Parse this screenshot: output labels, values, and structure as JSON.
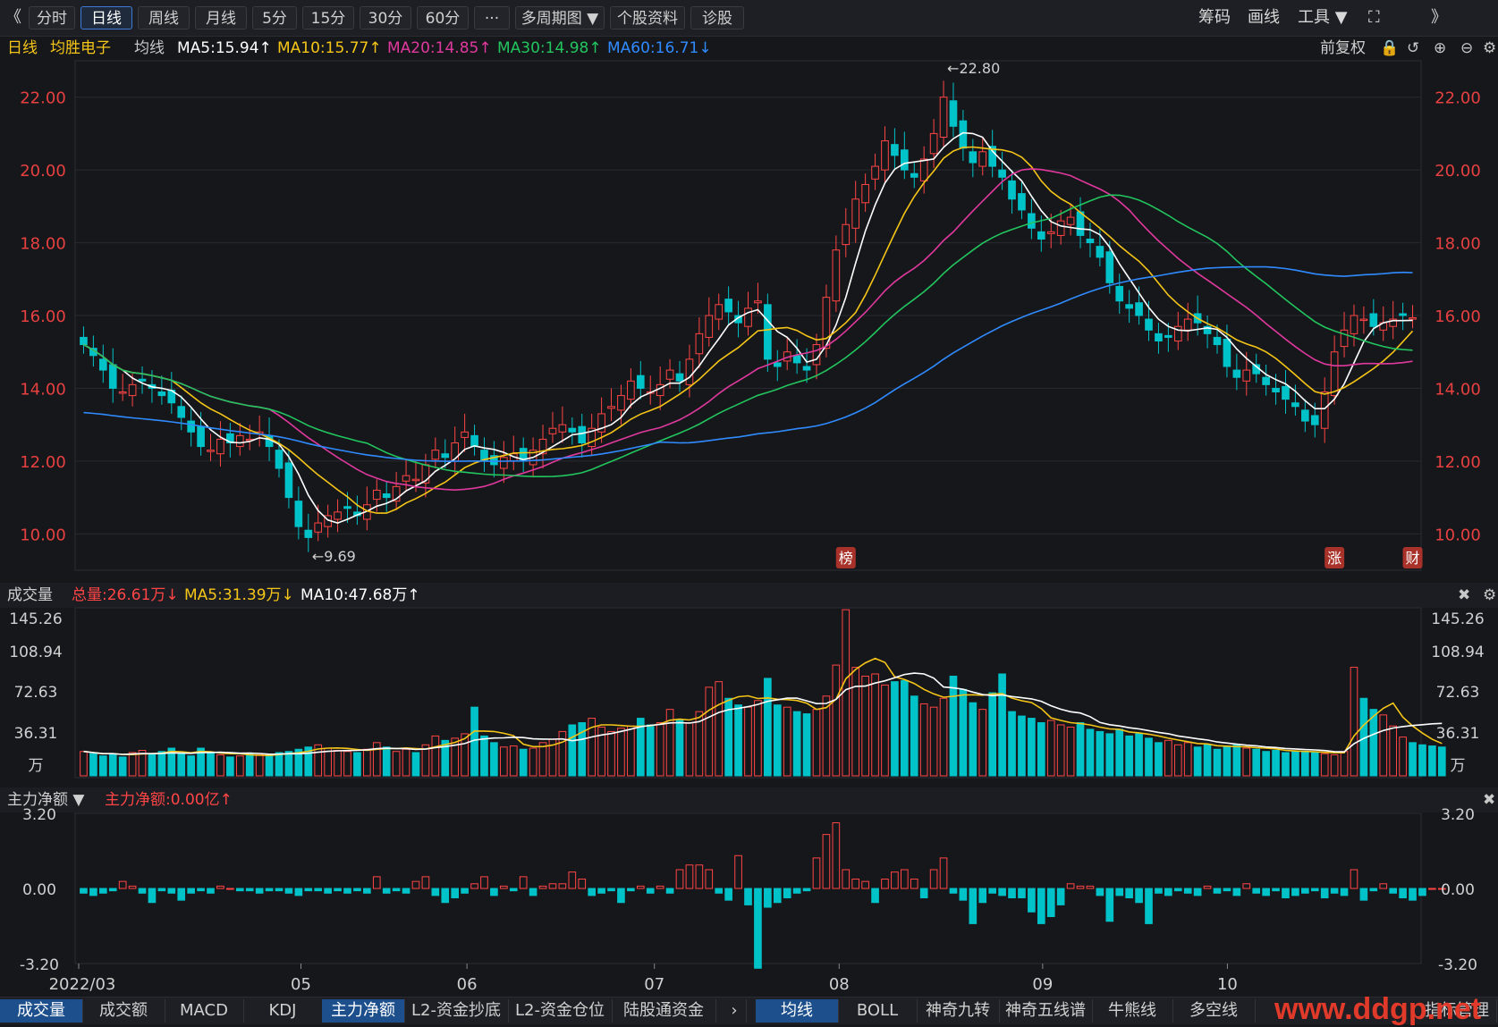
{
  "toolbar": {
    "back": "《",
    "tabs": [
      "分时",
      "日线",
      "周线",
      "月线",
      "5分",
      "15分",
      "30分",
      "60分",
      "···",
      "多周期图 ▼",
      "个股资料",
      "诊股"
    ],
    "active_tab": 1,
    "right": [
      "筹码",
      "画线",
      "工具 ▼",
      "⛶",
      "》"
    ]
  },
  "main_header": {
    "period": "日线",
    "stock_name": "均胜电子",
    "ma_label": "均线",
    "ma5": "MA5:15.94↑",
    "ma10": "MA10:15.77↑",
    "ma20": "MA20:14.85↑",
    "ma30": "MA30:14.98↑",
    "ma60": "MA60:16.71↓",
    "adjust": "前复权"
  },
  "price_axis": [
    "22.00",
    "20.00",
    "18.00",
    "16.00",
    "14.00",
    "12.00",
    "10.00"
  ],
  "annotations": {
    "high": "←22.80",
    "low": "←9.69",
    "tag1": "榜",
    "tag2": "涨",
    "tag3": "财"
  },
  "volume_header": {
    "label": "成交量",
    "total": "总量:26.61万↓",
    "ma5": "MA5:31.39万↓",
    "ma10": "MA10:47.68万↑"
  },
  "volume_axis": [
    "145.26",
    "108.94",
    "72.63",
    "36.31",
    "万"
  ],
  "flow_header": {
    "label": "主力净额 ▼",
    "value": "主力净额:0.00亿↑"
  },
  "flow_axis": [
    "3.20",
    "0.00",
    "-3.20"
  ],
  "x_axis": [
    "2022/03",
    "05",
    "06",
    "07",
    "08",
    "09",
    "10"
  ],
  "bottom_tabs_left": [
    "成交量",
    "成交额",
    "MACD",
    "KDJ",
    "主力净额",
    "L2-资金抄底",
    "L2-资金仓位",
    "陆股通资金"
  ],
  "bottom_tabs_right": [
    "均线",
    "BOLL",
    "神奇九转",
    "神奇五线谱",
    "牛熊线",
    "多空线"
  ],
  "bottom_right": "指标管理",
  "watermark": "www.ddgp.net",
  "colors": {
    "up": "#ff4545",
    "down": "#00c3c9",
    "ma5": "#ffffff",
    "ma10": "#f5c518",
    "ma20": "#e0399e",
    "ma30": "#22c55e",
    "ma60": "#2f8bff"
  },
  "chart_data": [
    {
      "type": "candlestick",
      "title": "均胜电子 日线",
      "x_ticks": [
        "2022/03",
        "05",
        "06",
        "07",
        "08",
        "09",
        "10"
      ],
      "ylim": [
        9.0,
        23.0
      ],
      "ohlc_close": [
        15.2,
        14.9,
        14.5,
        14.0,
        13.9,
        14.1,
        14.2,
        14.0,
        13.8,
        13.6,
        13.2,
        12.8,
        12.4,
        12.3,
        12.6,
        12.5,
        12.7,
        12.6,
        12.8,
        12.4,
        11.8,
        11.0,
        10.2,
        9.9,
        10.3,
        10.5,
        10.6,
        10.7,
        10.5,
        10.8,
        11.2,
        11.0,
        11.3,
        11.6,
        11.5,
        11.9,
        12.3,
        12.1,
        12.5,
        12.8,
        12.4,
        12.0,
        11.9,
        12.1,
        12.2,
        12.0,
        12.3,
        12.6,
        12.9,
        13.0,
        12.8,
        12.5,
        12.9,
        13.3,
        13.5,
        13.8,
        14.2,
        14.0,
        13.9,
        14.1,
        14.5,
        14.2,
        14.8,
        15.5,
        16.0,
        16.3,
        16.1,
        15.8,
        16.2,
        16.4,
        14.8,
        14.6,
        15.0,
        14.7,
        14.5,
        15.2,
        16.5,
        17.8,
        18.5,
        19.2,
        19.6,
        20.1,
        20.8,
        20.4,
        20.0,
        19.8,
        20.3,
        21.0,
        22.0,
        21.2,
        20.6,
        20.2,
        20.5,
        20.1,
        19.8,
        19.2,
        18.9,
        18.4,
        18.1,
        18.3,
        18.6,
        18.7,
        18.2,
        18.0,
        17.6,
        16.9,
        16.4,
        16.2,
        16.0,
        15.6,
        15.3,
        15.4,
        15.7,
        15.9,
        15.8,
        15.5,
        15.2,
        14.6,
        14.3,
        14.5,
        14.4,
        14.1,
        13.9,
        13.7,
        13.5,
        13.1,
        13.0,
        13.9,
        15.0,
        15.6,
        16.0,
        15.9,
        15.7,
        15.8,
        15.9,
        16.0,
        15.94
      ],
      "ma_last": {
        "MA5": 15.94,
        "MA10": 15.77,
        "MA20": 14.85,
        "MA30": 14.98,
        "MA60": 16.71
      },
      "high_label": 22.8,
      "low_label": 9.69
    },
    {
      "type": "bar",
      "title": "成交量",
      "unit": "万",
      "ylim": [
        0,
        145.26
      ],
      "values": [
        22,
        20,
        18,
        20,
        17,
        21,
        23,
        19,
        22,
        25,
        20,
        18,
        25,
        21,
        19,
        17,
        18,
        20,
        19,
        18,
        21,
        22,
        24,
        26,
        28,
        25,
        23,
        22,
        21,
        24,
        30,
        26,
        22,
        24,
        21,
        28,
        36,
        32,
        34,
        38,
        62,
        36,
        30,
        26,
        27,
        24,
        25,
        30,
        33,
        40,
        46,
        48,
        52,
        44,
        40,
        43,
        45,
        52,
        46,
        48,
        60,
        50,
        48,
        58,
        80,
        85,
        70,
        64,
        62,
        68,
        88,
        64,
        62,
        58,
        56,
        60,
        72,
        100,
        150,
        98,
        90,
        92,
        82,
        85,
        86,
        72,
        65,
        62,
        70,
        90,
        78,
        66,
        60,
        75,
        92,
        58,
        54,
        52,
        48,
        50,
        46,
        44,
        48,
        42,
        40,
        38,
        42,
        36,
        38,
        34,
        30,
        32,
        28,
        30,
        26,
        28,
        24,
        26,
        28,
        25,
        24,
        22,
        23,
        21,
        22,
        22,
        21,
        20,
        19,
        22,
        98,
        70,
        60,
        55,
        45,
        35,
        30,
        28,
        27,
        26
      ],
      "ma_last": {
        "MA5": 31.39,
        "MA10": 47.68
      },
      "total": 26.61
    },
    {
      "type": "bar",
      "title": "主力净额",
      "unit": "亿",
      "ylim": [
        -3.2,
        3.2
      ],
      "values": [
        -0.2,
        -0.3,
        -0.2,
        -0.1,
        0.3,
        0.1,
        -0.2,
        -0.6,
        -0.1,
        -0.2,
        -0.5,
        -0.2,
        -0.1,
        -0.2,
        0.1,
        0.0,
        -0.1,
        -0.1,
        -0.2,
        -0.1,
        -0.1,
        -0.2,
        -0.3,
        -0.1,
        -0.1,
        -0.2,
        -0.1,
        -0.2,
        -0.1,
        -0.2,
        0.5,
        -0.2,
        -0.1,
        -0.2,
        0.3,
        0.5,
        -0.3,
        -0.6,
        -0.4,
        -0.2,
        0.2,
        0.5,
        -0.3,
        0.1,
        -0.1,
        0.5,
        -0.3,
        0.1,
        0.2,
        0.2,
        0.7,
        0.4,
        -0.3,
        -0.2,
        -0.1,
        -0.6,
        -0.1,
        0.1,
        -0.2,
        0.1,
        -0.2,
        0.8,
        1.0,
        1.0,
        0.8,
        -0.2,
        -0.5,
        1.4,
        -0.7,
        -3.4,
        -0.8,
        -0.6,
        -0.4,
        -0.2,
        -0.1,
        1.3,
        2.3,
        2.8,
        0.8,
        0.4,
        0.3,
        -0.6,
        0.4,
        0.7,
        0.8,
        0.4,
        -0.4,
        0.8,
        1.3,
        -0.2,
        -0.5,
        -1.5,
        -0.6,
        -0.2,
        -0.3,
        -0.4,
        -0.4,
        -1.0,
        -1.5,
        -1.2,
        -0.7,
        0.2,
        0.1,
        0.1,
        -0.3,
        -1.4,
        -0.3,
        -0.4,
        -0.6,
        -1.5,
        -0.2,
        -0.3,
        -0.1,
        -0.2,
        -0.3,
        0.1,
        -0.2,
        -0.1,
        -0.3,
        0.2,
        -0.2,
        -0.3,
        -0.1,
        -0.4,
        -0.3,
        -0.2,
        -0.1,
        -0.4,
        -0.2,
        -0.3,
        0.8,
        -0.5,
        -0.1,
        0.2,
        -0.2,
        -0.4,
        -0.5,
        -0.3,
        0.0,
        0.0
      ]
    }
  ]
}
